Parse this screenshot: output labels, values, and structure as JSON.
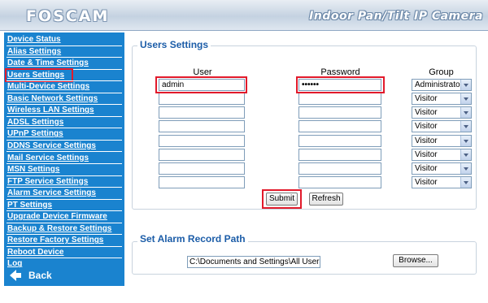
{
  "header": {
    "logo": "FOSCAM",
    "tagline": "Indoor Pan/Tilt IP Camera"
  },
  "sidebar": {
    "items": [
      {
        "label": "Device Status",
        "active": false
      },
      {
        "label": "Alias Settings",
        "active": false
      },
      {
        "label": "Date & Time Settings",
        "active": false
      },
      {
        "label": "Users Settings",
        "active": true
      },
      {
        "label": "Multi-Device Settings",
        "active": false
      },
      {
        "label": "Basic Network Settings",
        "active": false
      },
      {
        "label": "Wireless LAN Settings",
        "active": false
      },
      {
        "label": "ADSL Settings",
        "active": false
      },
      {
        "label": "UPnP Settings",
        "active": false
      },
      {
        "label": "DDNS Service Settings",
        "active": false
      },
      {
        "label": "Mail Service Settings",
        "active": false
      },
      {
        "label": "MSN Settings",
        "active": false
      },
      {
        "label": "FTP Service Settings",
        "active": false
      },
      {
        "label": "Alarm Service Settings",
        "active": false
      },
      {
        "label": "PT Settings",
        "active": false
      },
      {
        "label": "Upgrade Device Firmware",
        "active": false
      },
      {
        "label": "Backup & Restore Settings",
        "active": false
      },
      {
        "label": "Restore Factory Settings",
        "active": false
      },
      {
        "label": "Reboot Device",
        "active": false
      },
      {
        "label": "Log",
        "active": false
      }
    ],
    "back_label": "Back"
  },
  "users": {
    "title": "Users Settings",
    "columns": {
      "user": "User",
      "password": "Password",
      "group": "Group"
    },
    "rows": [
      {
        "user": "admin",
        "password": "••••••",
        "group": "Administrator"
      },
      {
        "user": "",
        "password": "",
        "group": "Visitor"
      },
      {
        "user": "",
        "password": "",
        "group": "Visitor"
      },
      {
        "user": "",
        "password": "",
        "group": "Visitor"
      },
      {
        "user": "",
        "password": "",
        "group": "Visitor"
      },
      {
        "user": "",
        "password": "",
        "group": "Visitor"
      },
      {
        "user": "",
        "password": "",
        "group": "Visitor"
      },
      {
        "user": "",
        "password": "",
        "group": "Visitor"
      }
    ],
    "submit_label": "Submit",
    "refresh_label": "Refresh"
  },
  "alarm_path": {
    "title": "Set Alarm Record Path",
    "path_value": "C:\\Documents and Settings\\All Users\\D",
    "browse_label": "Browse..."
  },
  "colors": {
    "sidebar_bg": "#1a83cf",
    "legend_text": "#1c5da8",
    "highlight": "#e21a2b"
  }
}
